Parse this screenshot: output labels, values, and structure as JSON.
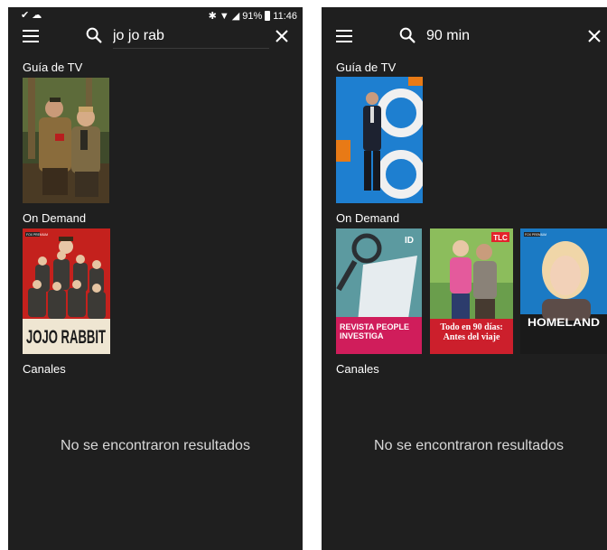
{
  "left_screen": {
    "status": {
      "battery": "91%",
      "time": "11:46"
    },
    "search": {
      "query": "jo jo rab"
    },
    "sections": {
      "tv_guide": {
        "label": "Guía de TV"
      },
      "on_demand": {
        "label": "On Demand",
        "items": [
          {
            "network": "FOX PREMIUM",
            "title": "JOJO RABBIT"
          }
        ]
      },
      "channels": {
        "label": "Canales",
        "empty": "No se encontraron resultados"
      }
    }
  },
  "right_screen": {
    "search": {
      "query": "90 min"
    },
    "sections": {
      "tv_guide": {
        "label": "Guía de TV"
      },
      "on_demand": {
        "label": "On Demand",
        "items": [
          {
            "network": "ID",
            "title": "REVISTA PEOPLE INVESTIGA"
          },
          {
            "network": "TLC",
            "title": "Todo en 90 días: Antes del viaje"
          },
          {
            "network": "FOX PREMIUM",
            "title": "HOMELAND"
          }
        ]
      },
      "channels": {
        "label": "Canales",
        "empty": "No se encontraron resultados"
      }
    }
  }
}
